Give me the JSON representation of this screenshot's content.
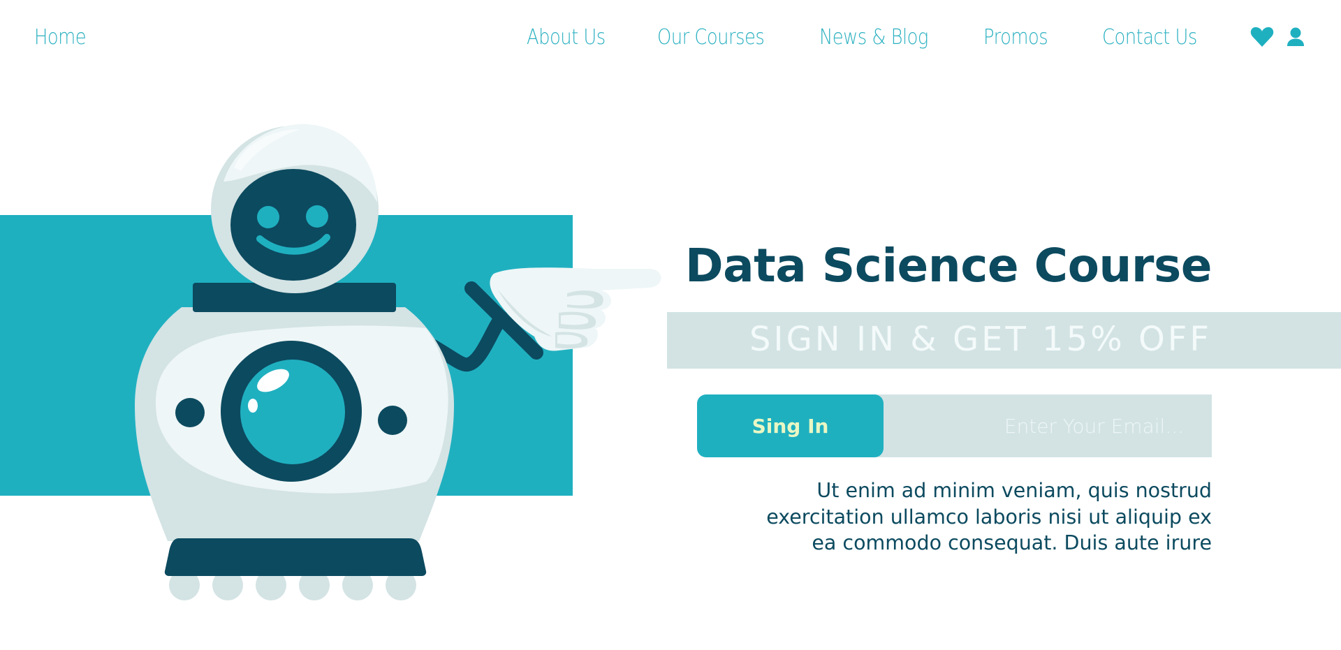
{
  "nav": {
    "home": "Home",
    "links": [
      "About Us",
      "Our Courses",
      "News & Blog",
      "Promos",
      "Contact Us"
    ],
    "icons": [
      "heart-icon",
      "user-icon"
    ]
  },
  "hero": {
    "title": "Data Science Course",
    "promo": "SIGN IN & GET 15% OFF",
    "signin_label": "Sing In",
    "email_placeholder": "Enter Your Email...",
    "email_value": "",
    "description_lines": [
      "Ut enim ad minim veniam, quis nostrud",
      "exercitation ullamco laboris nisi ut aliquip ex",
      "ea commodo consequat. Duis aute irure"
    ]
  },
  "illustration": {
    "subject": "smiling robot pointing at sign-in form"
  },
  "colors": {
    "accent": "#1fb0c0",
    "navy": "#0c4a5f",
    "band": "#d3e3e4",
    "robot_light": "#eef6f7",
    "robot_shade": "#d4e3e4",
    "signin_text": "#e9f7c4"
  }
}
